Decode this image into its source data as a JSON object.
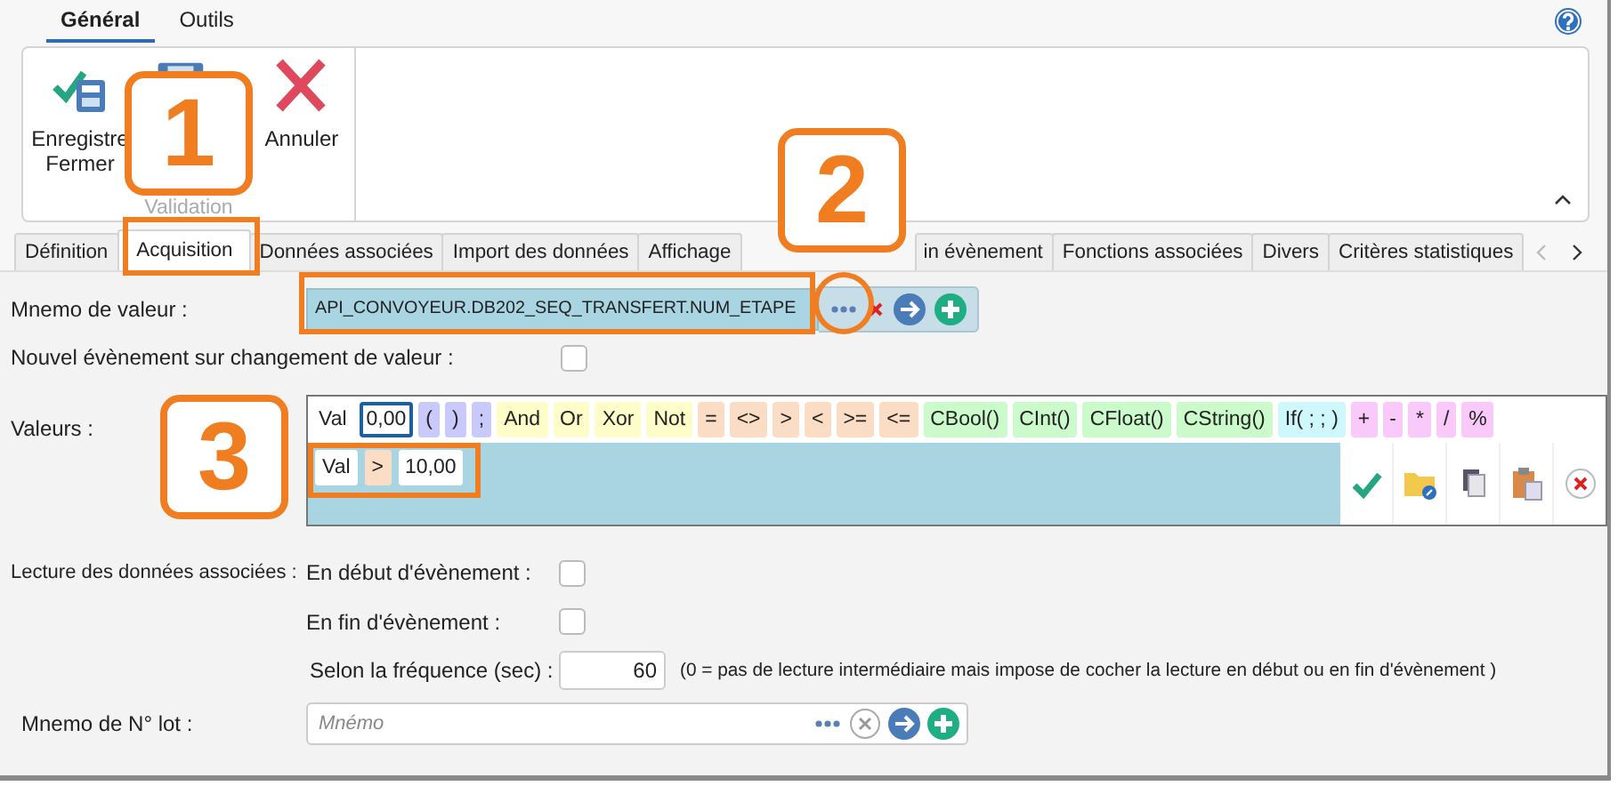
{
  "ribbon_tabs": [
    {
      "label": "Général",
      "selected": true
    },
    {
      "label": "Outils",
      "selected": false
    }
  ],
  "ribbon": {
    "buttons": [
      {
        "kind": "save-close",
        "lines": [
          "Enregistre",
          "Fermer"
        ]
      },
      {
        "kind": "save"
      },
      {
        "kind": "cancel",
        "lines": [
          "Annuler"
        ]
      }
    ],
    "group_label": "Validation"
  },
  "tabs": [
    {
      "label": "Définition",
      "selected": false
    },
    {
      "label": "Acquisition",
      "selected": true
    },
    {
      "label": "Données associées",
      "selected": false
    },
    {
      "label": "Import des données",
      "selected": false
    },
    {
      "label": "Affichage",
      "selected": false
    },
    {
      "label": "in évènement",
      "selected": false
    },
    {
      "label": "Fonctions associées",
      "selected": false
    },
    {
      "label": "Divers",
      "selected": false
    },
    {
      "label": "Critères statistiques",
      "selected": false
    }
  ],
  "mnemo_valeur": {
    "label": "Mnemo de valeur :",
    "value": "API_CONVOYEUR.DB202_SEQ_TRANSFERT.NUM_ETAPE"
  },
  "nouvel_evenement": {
    "label": "Nouvel évènement sur changement de valeur :",
    "checked": false
  },
  "valeurs": {
    "label": "Valeurs :",
    "palette": [
      {
        "text": "Val",
        "kind": "value"
      },
      {
        "text": "0,00",
        "kind": "number-input"
      },
      {
        "text": "(",
        "kind": "bracket"
      },
      {
        "text": ")",
        "kind": "bracket"
      },
      {
        "text": ";",
        "kind": "bracket"
      },
      {
        "text": "And",
        "kind": "logic"
      },
      {
        "text": "Or",
        "kind": "logic"
      },
      {
        "text": "Xor",
        "kind": "logic"
      },
      {
        "text": "Not",
        "kind": "logic"
      },
      {
        "text": "=",
        "kind": "comparison"
      },
      {
        "text": "<>",
        "kind": "comparison"
      },
      {
        "text": ">",
        "kind": "comparison"
      },
      {
        "text": "<",
        "kind": "comparison"
      },
      {
        "text": ">=",
        "kind": "comparison"
      },
      {
        "text": "<=",
        "kind": "comparison"
      },
      {
        "text": "CBool()",
        "kind": "function"
      },
      {
        "text": "CInt()",
        "kind": "function"
      },
      {
        "text": "CFloat()",
        "kind": "function"
      },
      {
        "text": "CString()",
        "kind": "function"
      },
      {
        "text": "If( ; ; )",
        "kind": "condition"
      },
      {
        "text": "+",
        "kind": "arithmetic"
      },
      {
        "text": "-",
        "kind": "arithmetic"
      },
      {
        "text": "*",
        "kind": "arithmetic"
      },
      {
        "text": "/",
        "kind": "arithmetic"
      },
      {
        "text": "%",
        "kind": "arithmetic"
      }
    ],
    "expression": [
      {
        "text": "Val",
        "kind": "value"
      },
      {
        "text": ">",
        "kind": "comparison"
      },
      {
        "text": "10,00",
        "kind": "number"
      }
    ]
  },
  "lecture": {
    "label": "Lecture des données associées :",
    "options": [
      {
        "label": "En début d'évènement :",
        "checked": false
      },
      {
        "label": "En fin d'évènement :",
        "checked": false
      }
    ],
    "frequence": {
      "label": "Selon la fréquence (sec) :",
      "value": "60",
      "note": "(0 = pas de lecture intermédiaire mais impose de cocher la lecture en début ou en fin d'évènement )"
    }
  },
  "mnemo_lot": {
    "label": "Mnemo de N° lot :",
    "placeholder": "Mnémo"
  },
  "callouts": [
    {
      "label": "1"
    },
    {
      "label": "2"
    },
    {
      "label": "3"
    }
  ]
}
